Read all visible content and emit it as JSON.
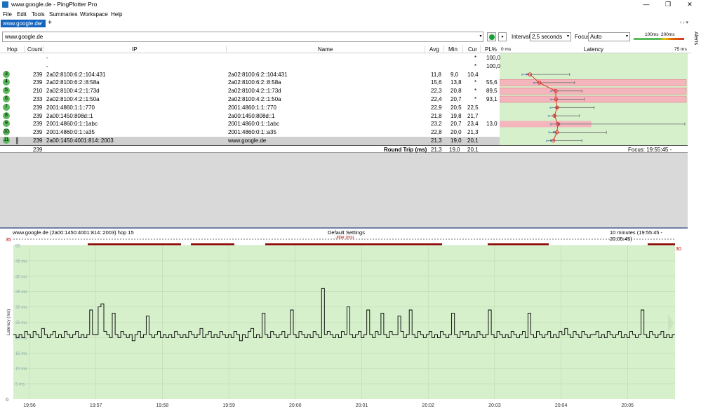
{
  "window": {
    "title": "www.google.de - PingPlotter Pro",
    "min": "—",
    "max": "❐",
    "close": "✕"
  },
  "menu": [
    "File",
    "Edit",
    "Tools",
    "Summaries",
    "Workspace",
    "Help"
  ],
  "tab": {
    "label": "www.google.de",
    "check": "✓",
    "add": "+"
  },
  "tabnav": "‹  ›  ▾",
  "alerts_label": "Alerts",
  "address": {
    "value": "www.google.de",
    "dropdown": "▾"
  },
  "interval": {
    "label": "Interval",
    "value": "2,5 seconds"
  },
  "focus": {
    "label": "Focus",
    "value": "Auto"
  },
  "legend": {
    "l1": "100ms",
    "l2": "200ms"
  },
  "columns": {
    "hop": "Hop",
    "count": "Count",
    "ip": "IP",
    "name": "Name",
    "avg": "Avg",
    "min": "Min",
    "cur": "Cur",
    "pl": "PL%",
    "lat0": "0 ms",
    "latency": "Latency",
    "lat75": "75 ms"
  },
  "rows": [
    {
      "hop": "",
      "count": "",
      "ip": "-",
      "name": "",
      "avg": "",
      "min": "",
      "cur": "*",
      "pl": "100,0",
      "lat": null
    },
    {
      "hop": "",
      "count": "",
      "ip": "-",
      "name": "",
      "avg": "",
      "min": "",
      "cur": "*",
      "pl": "100,0",
      "lat": null
    },
    {
      "hop": "3",
      "count": "239",
      "ip": "2a02:8100:6:2::104:431",
      "name": "2a02:8100:6:2::104:431",
      "avg": "11,8",
      "min": "9,0",
      "cur": "10,4",
      "pl": "",
      "lat": 11.8,
      "minv": 9.0,
      "maxv": 28,
      "curv": 10.4,
      "plv": 0
    },
    {
      "hop": "4",
      "count": "239",
      "ip": "2a02:8100:6:2::8:58a",
      "name": "2a02:8100:6:2::8:58a",
      "avg": "15,6",
      "min": "13,8",
      "cur": "*",
      "pl": "55,6",
      "lat": 15.6,
      "minv": 13.8,
      "maxv": 30,
      "curv": null,
      "plv": 55.6
    },
    {
      "hop": "5",
      "count": "210",
      "ip": "2a02:8100:4:2::1:73d",
      "name": "2a02:8100:4:2::1:73d",
      "avg": "22,3",
      "min": "20,8",
      "cur": "*",
      "pl": "89,5",
      "lat": 22.3,
      "minv": 20.8,
      "maxv": 33,
      "curv": null,
      "plv": 89.5
    },
    {
      "hop": "6",
      "count": "233",
      "ip": "2a02:8100:4:2::1:50a",
      "name": "2a02:8100:4:2::1:50a",
      "avg": "22,4",
      "min": "20,7",
      "cur": "*",
      "pl": "93,1",
      "lat": 22.4,
      "minv": 20.7,
      "maxv": 34,
      "curv": null,
      "plv": 93.1
    },
    {
      "hop": "7",
      "count": "239",
      "ip": "2001:4860:1:1::770",
      "name": "2001:4860:1:1::770",
      "avg": "22,9",
      "min": "20,5",
      "cur": "22,5",
      "pl": "",
      "lat": 22.9,
      "minv": 20.5,
      "maxv": 38,
      "curv": 22.5,
      "plv": 0
    },
    {
      "hop": "8",
      "count": "239",
      "ip": "2a00:1450:808d::1",
      "name": "2a00:1450:808d::1",
      "avg": "21,8",
      "min": "19,8",
      "cur": "21,7",
      "pl": "",
      "lat": 21.8,
      "minv": 19.8,
      "maxv": 32,
      "curv": 21.7,
      "plv": 0
    },
    {
      "hop": "9",
      "count": "239",
      "ip": "2001:4860:0:1::1abc",
      "name": "2001:4860:0:1::1abc",
      "avg": "23,2",
      "min": "20,7",
      "cur": "23,4",
      "pl": "13,0",
      "lat": 23.2,
      "minv": 20.7,
      "maxv": 75,
      "curv": 23.4,
      "plv": 13.0
    },
    {
      "hop": "10",
      "count": "239",
      "ip": "2001:4860:0:1::a35",
      "name": "2001:4860:0:1::a35",
      "avg": "22,8",
      "min": "20,0",
      "cur": "21,3",
      "pl": "",
      "lat": 22.8,
      "minv": 20.0,
      "maxv": 43,
      "curv": 21.3,
      "plv": 0
    },
    {
      "hop": "11",
      "count": "239",
      "ip": "2a00:1450:4001:814::2003",
      "name": "www.google.de",
      "avg": "21,3",
      "min": "19,0",
      "cur": "20,1",
      "pl": "",
      "lat": 21.3,
      "minv": 19.0,
      "maxv": 33,
      "curv": 20.1,
      "plv": 0
    }
  ],
  "roundtrip": {
    "count": "239",
    "label": "Round Trip (ms)",
    "avg": "21,3",
    "min": "19,0",
    "cur": "20,1",
    "focus": "Focus: 19:55:45 - 20:05:45"
  },
  "chart_header": {
    "target": "www.google.de (2a00:1450:4001:814::2003) hop 15",
    "settings": "Default Settings",
    "range": "10 minutes (19:55:45 - 20:05:45)"
  },
  "colors": {
    "green": "#d7f0cc",
    "pl_red": "#f4b6bc",
    "loss_red": "#8b0000",
    "line": "#000000",
    "accent": "#1565c0"
  },
  "chart_data": {
    "type": "line",
    "ylabel": "Latency (ms)",
    "ylim": [
      0,
      50
    ],
    "yticks": [
      "5 ms",
      "10 ms",
      "15 ms",
      "20 ms",
      "25 ms",
      "30 ms",
      "35 ms",
      "40 ms",
      "45 ms",
      "50"
    ],
    "ytick_values": [
      5,
      10,
      15,
      20,
      25,
      30,
      35,
      40,
      45,
      50
    ],
    "xlabels": [
      "19:56",
      "19:57",
      "19:58",
      "19:59",
      "20:00",
      "20:01",
      "20:02",
      "20:03",
      "20:04",
      "20:05"
    ],
    "jitter_label": "Jitter (ms)",
    "jitter_left": "35",
    "jitter_right": "30",
    "series": [
      {
        "values": [
          21,
          20,
          21,
          20,
          22,
          21,
          20,
          22,
          21,
          20,
          23,
          21,
          20,
          21,
          22,
          20,
          21,
          20,
          22,
          21,
          20,
          21,
          22,
          20,
          21,
          20,
          21,
          29,
          21,
          21,
          30,
          31,
          22,
          21,
          20,
          28,
          21,
          20,
          22,
          21,
          20,
          21,
          19,
          21,
          22,
          20,
          21,
          27,
          21,
          20,
          21,
          22,
          20,
          21,
          20,
          21,
          20,
          22,
          21,
          20,
          21,
          20,
          22,
          21,
          20,
          21,
          23,
          20,
          21,
          22,
          20,
          21,
          20,
          22,
          21,
          20,
          21,
          20,
          22,
          21,
          19,
          21,
          20,
          22,
          23,
          20,
          21,
          20,
          28,
          21,
          20,
          22,
          21,
          20,
          21,
          22,
          20,
          21,
          29,
          21,
          20,
          22,
          21,
          20,
          21,
          20,
          22,
          21,
          20,
          36,
          21,
          22,
          21,
          20,
          21,
          20,
          22,
          21,
          30,
          21,
          20,
          21,
          22,
          20,
          21,
          29,
          21,
          20,
          22,
          21,
          28,
          21,
          20,
          22,
          21,
          21,
          27,
          22,
          20,
          21,
          29,
          21,
          20,
          22,
          21,
          20,
          21,
          22,
          20,
          21,
          20,
          22,
          21,
          20,
          21,
          28,
          21,
          20,
          22,
          21,
          22,
          20,
          21,
          20,
          22,
          21,
          20,
          21,
          29,
          21,
          20,
          22,
          21,
          20,
          21,
          20,
          22,
          21,
          20,
          21,
          22,
          20,
          28,
          21,
          20,
          22,
          21,
          20,
          21,
          22,
          20,
          21,
          20,
          22,
          21,
          23,
          21,
          20,
          22,
          21,
          20,
          22,
          21,
          20,
          21,
          21,
          22,
          20,
          21,
          20,
          22,
          21,
          20,
          21,
          22,
          20,
          21,
          20,
          22,
          21,
          20,
          21,
          29,
          21,
          20,
          22,
          21,
          20,
          21,
          22,
          20,
          21,
          20,
          21
        ]
      }
    ]
  }
}
